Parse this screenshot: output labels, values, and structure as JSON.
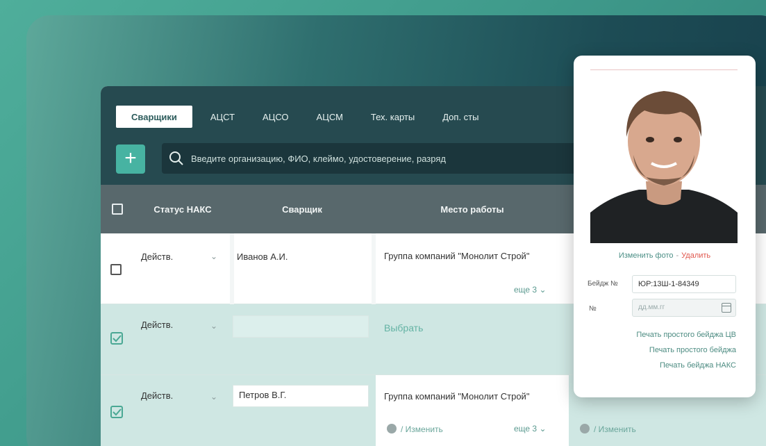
{
  "tabs": [
    {
      "label": "Сварщики",
      "active": true
    },
    {
      "label": "АЦСТ",
      "active": false
    },
    {
      "label": "АЦСО",
      "active": false
    },
    {
      "label": "АЦСМ",
      "active": false
    },
    {
      "label": "Тех. карты",
      "active": false
    },
    {
      "label": "Доп. сты",
      "active": false
    }
  ],
  "toolbar": {
    "add_label": "+"
  },
  "search": {
    "placeholder": "Введите организацию, ФИО, клеймо, удостоверение, разряд",
    "value": ""
  },
  "table": {
    "headers": {
      "status": "Статус НАКС",
      "welder": "Сварщик",
      "workplace": "Место работы"
    },
    "rows": [
      {
        "checked": false,
        "status": "Действ.",
        "welder": "Иванов А.И.",
        "workplace": "Группа компаний \"Монолит Строй\"",
        "more": "еще 3",
        "pick": "",
        "edit": ""
      },
      {
        "checked": true,
        "status": "Действ.",
        "welder": "",
        "workplace": "",
        "more": "",
        "pick": "Выбрать",
        "edit": ""
      },
      {
        "checked": true,
        "status": "Действ.",
        "welder": "Петров В.Г.",
        "workplace": "Группа компаний \"Монолит Строй\"",
        "more": "еще 3",
        "pick": "",
        "edit": "/ Изменить",
        "edit2": "/ Изменить"
      }
    ]
  },
  "popup": {
    "change_photo": "Изменить фото",
    "delete": "Удалить",
    "badge_label": "Бейдж №",
    "badge_value": "ЮР:13Ш-1-84349",
    "date_label": "№",
    "date_placeholder": "дд.мм.гг",
    "print_links": [
      "Печать простого бейджа ЦВ",
      "Печать простого бейджа",
      "Печать бейджа НАКС"
    ]
  },
  "colors": {
    "accent": "#47b3a2",
    "topbar": "#264a50",
    "header": "#58686c",
    "selected_row": "#cfe7e3"
  }
}
